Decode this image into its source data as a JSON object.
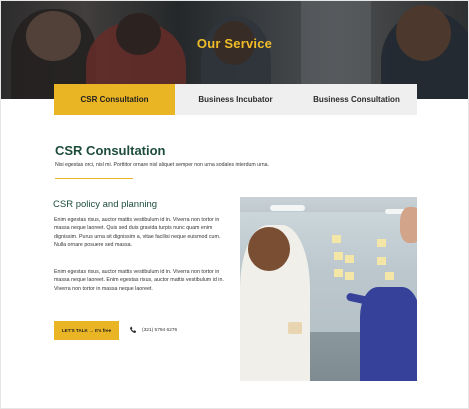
{
  "hero": {
    "title": "Our Service"
  },
  "tabs": [
    {
      "label": "CSR Consultation",
      "active": true
    },
    {
      "label": "Business Incubator",
      "active": false
    },
    {
      "label": "Business Consultation",
      "active": false
    }
  ],
  "section": {
    "title": "CSR Consultation",
    "subtitle": "Nisi egestas orci, nisl mi. Porttitor ornare nisl aliquet semper non urna sodales interdum urna."
  },
  "content": {
    "heading": "CSR policy and planning",
    "paragraph1": "Enim egestas risus, auctor mattis vestibulum id in. Viverra non tortor in massa neque laoreet. Quis sed duis gravida turpis nunc quam enim dignissim. Purus urna sit dignissim a, vitae facilisi neque euismod cum. Nulla ornare posuere sed massa.",
    "paragraph2": "Enim egestas risus, auctor mattis vestibulum id in. Viverra non tortor in massa neque laoreet. Enim egestas risus, auctor mattis vestibulum id in. Viverra non tortor in massa neque laoreet.",
    "cta_label": "LET'S TALK  →  It's free",
    "phone": "(321) 5794 6276"
  },
  "colors": {
    "accent": "#eab524",
    "heading_green": "#1d4d3a",
    "tab_inactive": "#efefef"
  },
  "icons": {
    "phone": "phone-icon"
  }
}
